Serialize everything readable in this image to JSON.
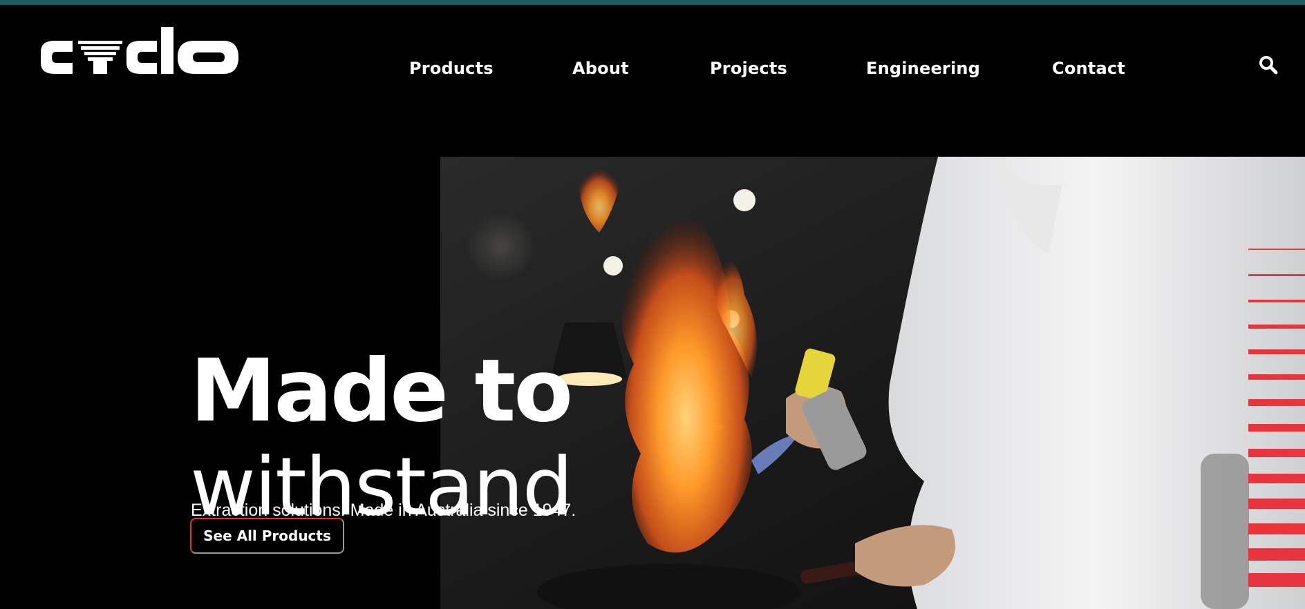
{
  "brand": {
    "name": "cyclo",
    "accent": "#e8343c",
    "top_bar_color": "#1b5f63"
  },
  "nav": {
    "items": [
      {
        "label": "Products"
      },
      {
        "label": "About"
      },
      {
        "label": "Projects"
      },
      {
        "label": "Engineering"
      },
      {
        "label": "Contact"
      }
    ],
    "search_icon": "search-icon"
  },
  "hero": {
    "title_line1": "Made to",
    "title_line2": "withstand",
    "subtitle": "Extraction solutions. Made in Australia since 1947.",
    "cta_label": "See All Products",
    "image_description_icon": "chef-flambe-photo"
  }
}
